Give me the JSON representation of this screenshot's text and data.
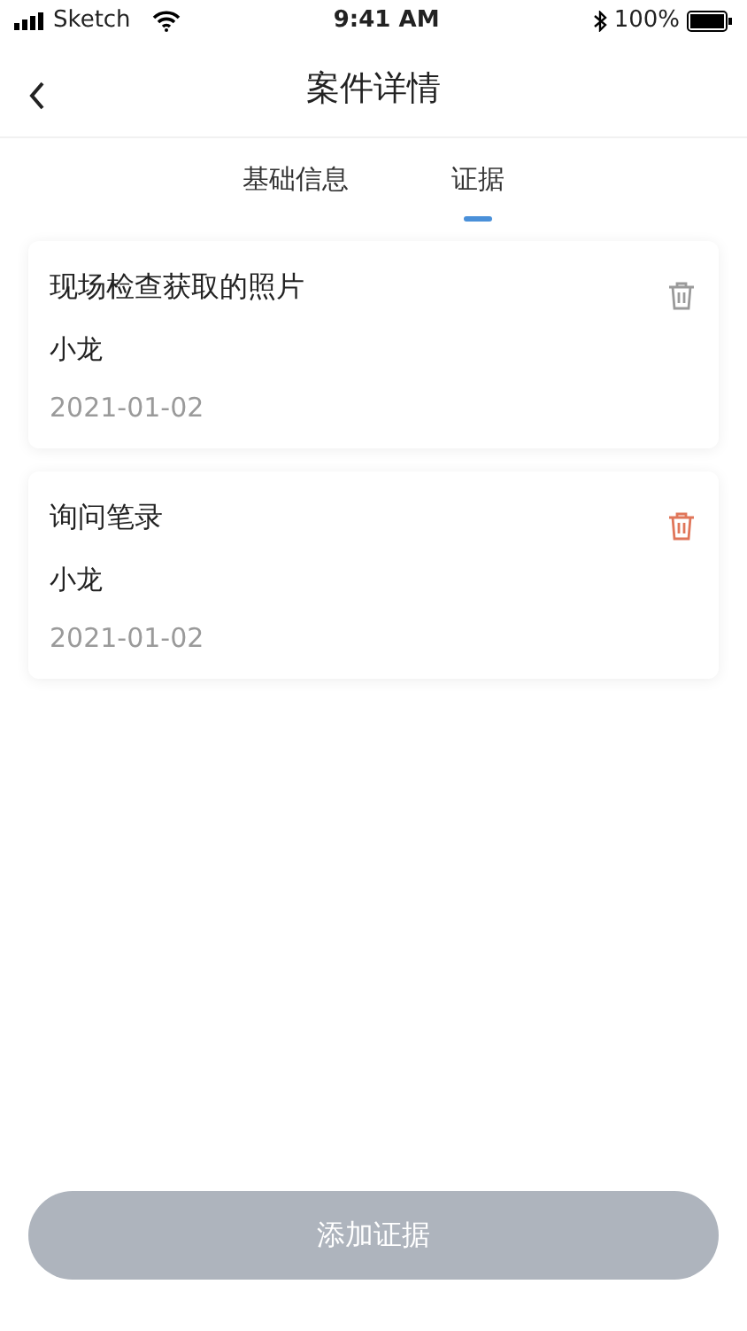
{
  "status_bar": {
    "carrier": "Sketch",
    "time": "9:41 AM",
    "battery": "100%"
  },
  "nav": {
    "title": "案件详情"
  },
  "tabs": [
    {
      "label": "基础信息",
      "selected": false
    },
    {
      "label": "证据",
      "selected": true
    }
  ],
  "evidence": [
    {
      "title": "现场检查获取的照片",
      "person": "小龙",
      "date": "2021-01-02",
      "color": "#9a9a9a"
    },
    {
      "title": "询问笔录",
      "person": "小龙",
      "date": "2021-01-02",
      "color": "#e0765a"
    }
  ],
  "add_button": {
    "label": "添加证据",
    "disabled": true
  }
}
